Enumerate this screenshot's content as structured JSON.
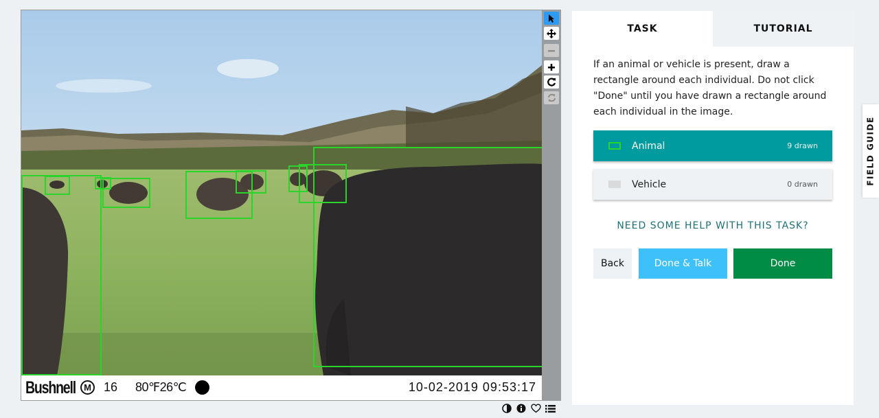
{
  "camera": {
    "brand": "Bushnell",
    "mode": "M",
    "number": "16",
    "temperature": "80℉26℃",
    "datetime": "10-02-2019 09:53:17"
  },
  "tools": [
    "pointer-icon",
    "move-icon",
    "zoom-out-icon",
    "zoom-in-icon",
    "rotate-icon",
    "reset-icon"
  ],
  "meta_icons": [
    "contrast-icon",
    "info-icon",
    "heart-icon",
    "collections-icon"
  ],
  "task_panel": {
    "tabs": [
      {
        "label": "TASK",
        "active": true
      },
      {
        "label": "TUTORIAL",
        "active": false
      }
    ],
    "instructions": "If an animal or vehicle is present, draw a rectangle around each individual. Do not click \"Done\" until you have drawn a rectangle around each individual in the image.",
    "options": [
      {
        "label": "Animal",
        "count": "9 drawn",
        "color": "#2bd42b"
      },
      {
        "label": "Vehicle",
        "count": "0 drawn",
        "color": "#d8dadc"
      }
    ],
    "help_link": "NEED SOME HELP WITH THIS TASK?",
    "buttons": {
      "back": "Back",
      "done_talk": "Done & Talk",
      "done": "Done"
    }
  },
  "field_guide": "FIELD GUIDE",
  "colors": {
    "accent_teal": "#009b9f",
    "done_green": "#008c45",
    "talk_blue": "#3ec1fb",
    "box_green": "#2bd42b"
  }
}
